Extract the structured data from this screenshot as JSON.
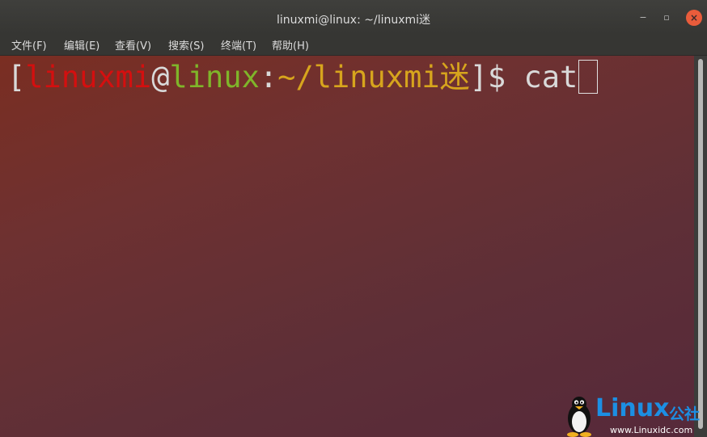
{
  "window": {
    "title": "linuxmi@linux: ~/linuxmi迷",
    "controls": {
      "minimize_icon": "minimize-icon",
      "maximize_icon": "maximize-icon",
      "close_icon": "close-icon"
    }
  },
  "menu": {
    "items": [
      {
        "label": "文件(F)"
      },
      {
        "label": "编辑(E)"
      },
      {
        "label": "查看(V)"
      },
      {
        "label": "搜索(S)"
      },
      {
        "label": "终端(T)"
      },
      {
        "label": "帮助(H)"
      }
    ]
  },
  "terminal": {
    "prompt": {
      "open_bracket": "[",
      "user": "linuxmi",
      "at": "@",
      "host": "linux",
      "colon": ":",
      "path": "~/linuxmi迷",
      "close": "]$",
      "command": " cat"
    },
    "colors": {
      "background": "#6e3131",
      "user": "#d40f0f",
      "host": "#7fb52a",
      "path": "#d7a51d",
      "text": "#d9d9d9"
    }
  },
  "watermark": {
    "brand": "Linux",
    "brand_cn": "公社",
    "url": "www.Linuxidc.com",
    "icon": "tux-penguin-icon"
  }
}
